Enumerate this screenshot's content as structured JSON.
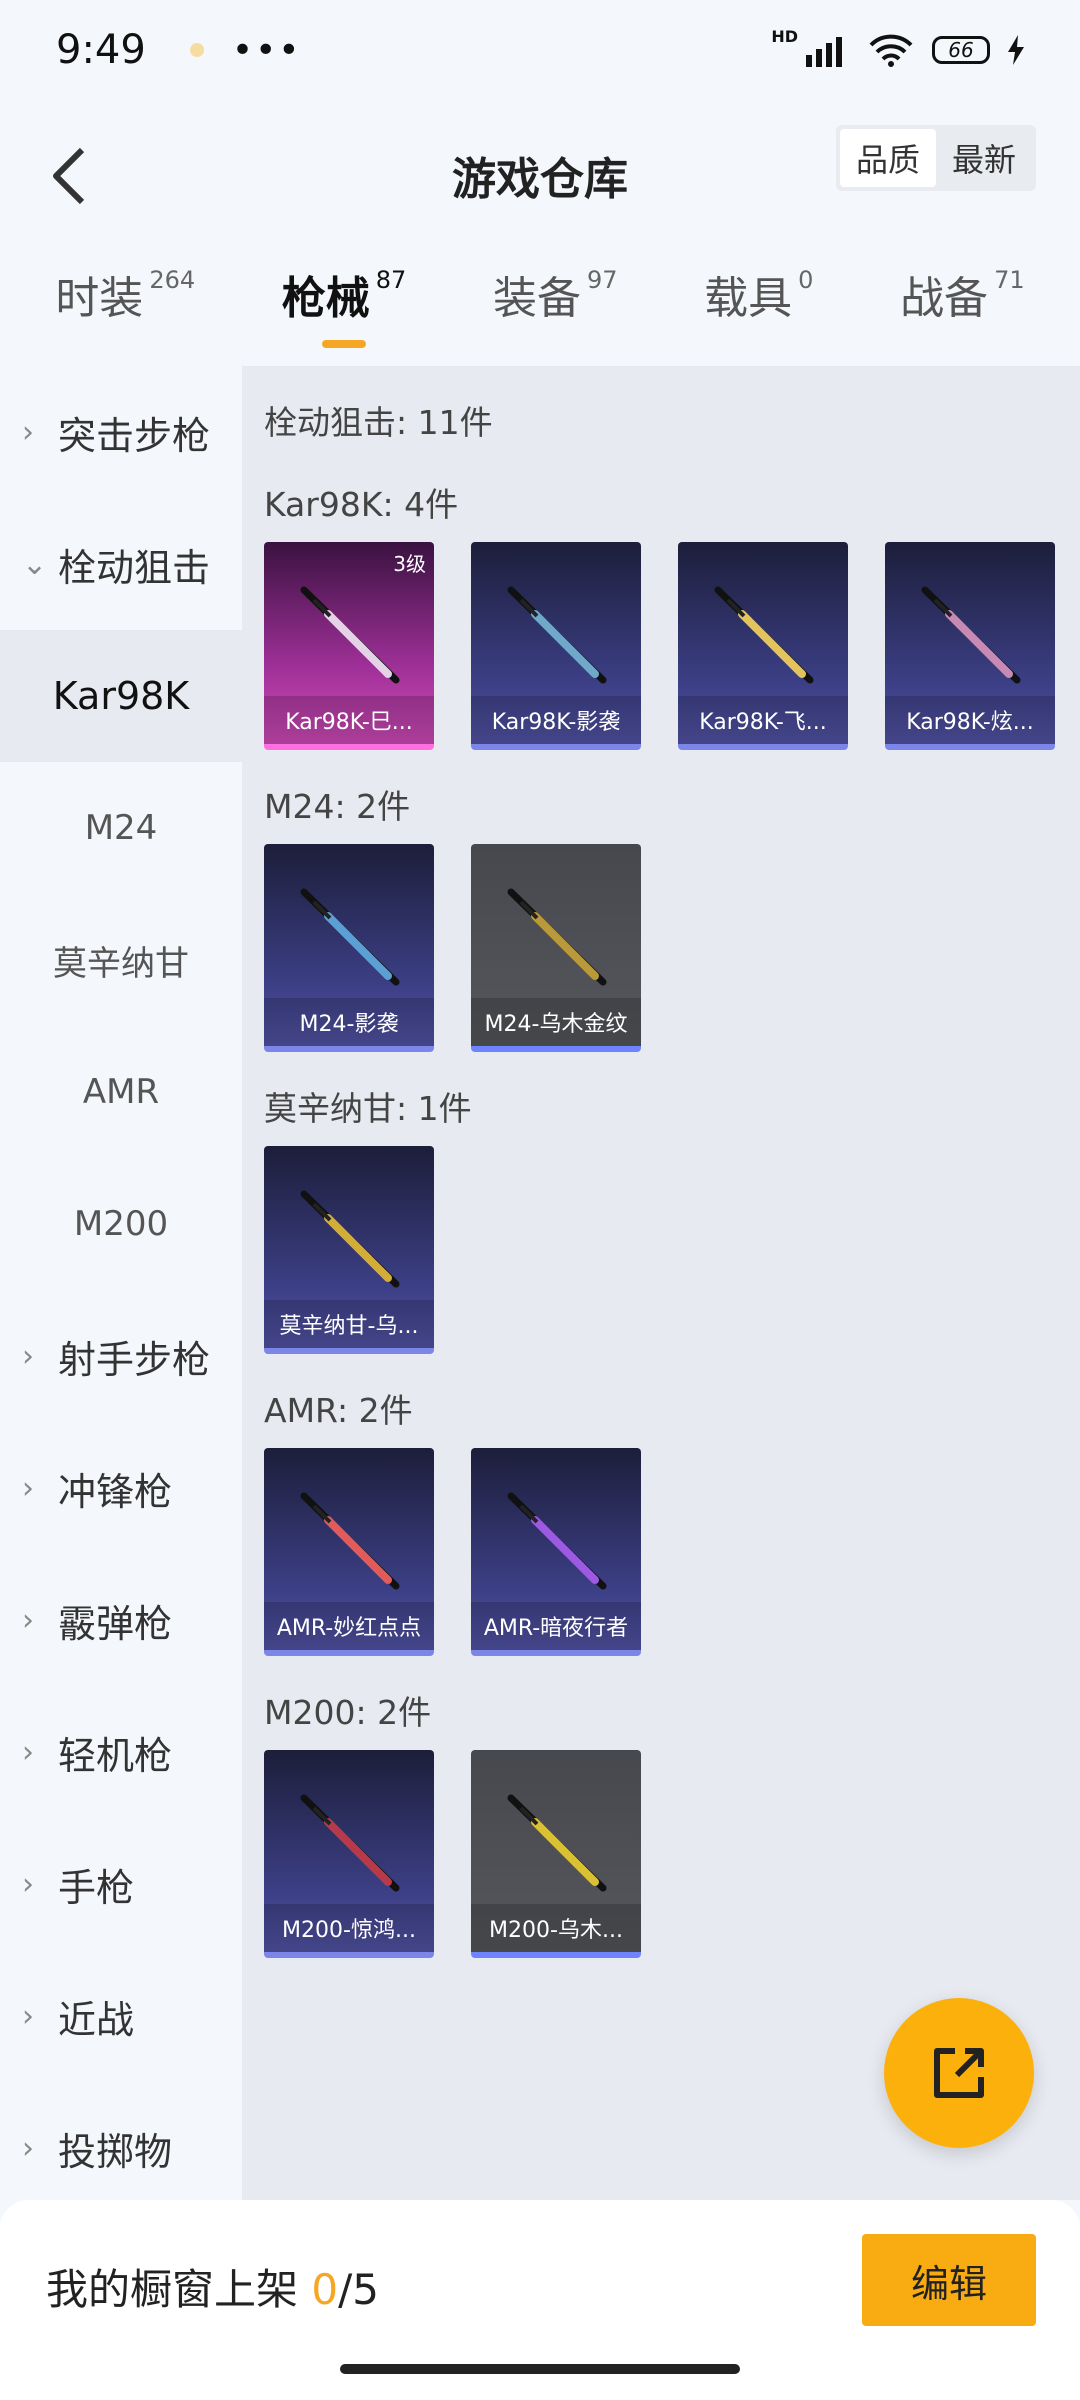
{
  "status_bar": {
    "time": "9:49",
    "more": "•••",
    "hd": "HD",
    "battery": "66"
  },
  "header": {
    "title": "游戏仓库",
    "sort_quality": "品质",
    "sort_latest": "最新"
  },
  "tabs": [
    {
      "label": "时装",
      "count": "264"
    },
    {
      "label": "枪械",
      "count": "87"
    },
    {
      "label": "装备",
      "count": "97"
    },
    {
      "label": "载具",
      "count": "0"
    },
    {
      "label": "战备",
      "count": "71"
    }
  ],
  "sidebar": {
    "assault": "突击步枪",
    "bolt": "栓动狙击",
    "subs": [
      "Kar98K",
      "M24",
      "莫辛纳甘",
      "AMR",
      "M200"
    ],
    "rest": [
      "射手步枪",
      "冲锋枪",
      "霰弹枪",
      "轻机枪",
      "手枪",
      "近战",
      "投掷物"
    ]
  },
  "content": {
    "section": "栓动狙击: 11件",
    "groups": [
      {
        "title": "Kar98K: 4件",
        "items": [
          {
            "name": "Kar98K-巳...",
            "level": "3级",
            "rarity": "pink",
            "color": "#e4d3e6"
          },
          {
            "name": "Kar98K-影袭",
            "rarity": "blue",
            "color": "#6fa8c9"
          },
          {
            "name": "Kar98K-飞...",
            "rarity": "blue",
            "color": "#e3c35a"
          },
          {
            "name": "Kar98K-炫...",
            "rarity": "blue",
            "color": "#c58bb4"
          }
        ]
      },
      {
        "title": "M24: 2件",
        "items": [
          {
            "name": "M24-影袭",
            "rarity": "blue",
            "color": "#5aa0d4"
          },
          {
            "name": "M24-乌木金纹",
            "rarity": "grey",
            "color": "#b9993a"
          }
        ]
      },
      {
        "title": "莫辛纳甘: 1件",
        "items": [
          {
            "name": "莫辛纳甘-乌...",
            "rarity": "blue",
            "color": "#d4ad36"
          }
        ]
      },
      {
        "title": "AMR: 2件",
        "items": [
          {
            "name": "AMR-妙红点点",
            "rarity": "blue",
            "color": "#e25b5b"
          },
          {
            "name": "AMR-暗夜行者",
            "rarity": "blue",
            "color": "#9b5ae0"
          }
        ]
      },
      {
        "title": "M200: 2件",
        "items": [
          {
            "name": "M200-惊鸿...",
            "rarity": "blue",
            "color": "#b73a4a"
          },
          {
            "name": "M200-乌木...",
            "rarity": "grey",
            "color": "#d9c036"
          }
        ]
      }
    ]
  },
  "bottom": {
    "shelf_label": "我的橱窗上架 ",
    "current": "0",
    "total": "/5",
    "edit": "编辑"
  }
}
